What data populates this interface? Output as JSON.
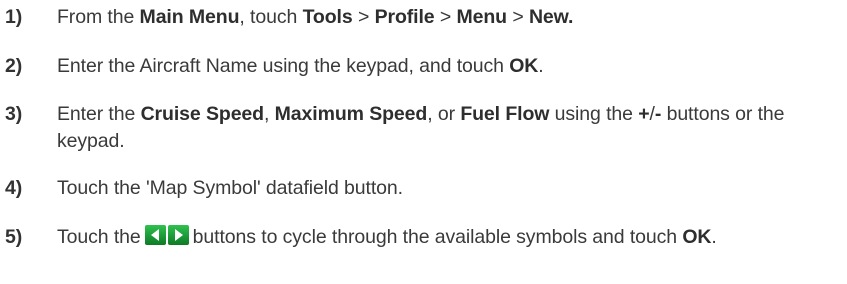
{
  "steps": [
    {
      "number": "1)",
      "parts": {
        "t1": "From the ",
        "b1": "Main Menu",
        "t2": ", touch ",
        "b2": "Tools",
        "t3": " > ",
        "b3": "Profile",
        "t4": " > ",
        "b4": "Menu",
        "t5": " > ",
        "b5": "New."
      }
    },
    {
      "number": "2)",
      "parts": {
        "t1": "Enter the Aircraft Name using the keypad, and touch ",
        "b1": "OK",
        "t2": "."
      }
    },
    {
      "number": "3)",
      "parts": {
        "t1": "Enter the ",
        "b1": "Cruise Speed",
        "t2": ", ",
        "b2": "Maximum Speed",
        "t3": ", or ",
        "b3": "Fuel Flow",
        "t4": " using the ",
        "b4": "+",
        "t5": "/",
        "b5": "-",
        "t6": " buttons or the keypad."
      }
    },
    {
      "number": "4)",
      "parts": {
        "t1": "Touch the 'Map Symbol' datafield button."
      }
    },
    {
      "number": "5)",
      "parts": {
        "t1": "Touch the",
        "icon": "left-right-arrow-buttons-icon",
        "t2": "buttons to cycle through the available symbols and touch ",
        "b1": "OK",
        "t3": "."
      }
    }
  ],
  "colors": {
    "text": "#3a3a3a",
    "icon_bg": "#18a83a",
    "icon_bg_dark": "#0d7a26",
    "icon_arrow": "#ffffff"
  }
}
